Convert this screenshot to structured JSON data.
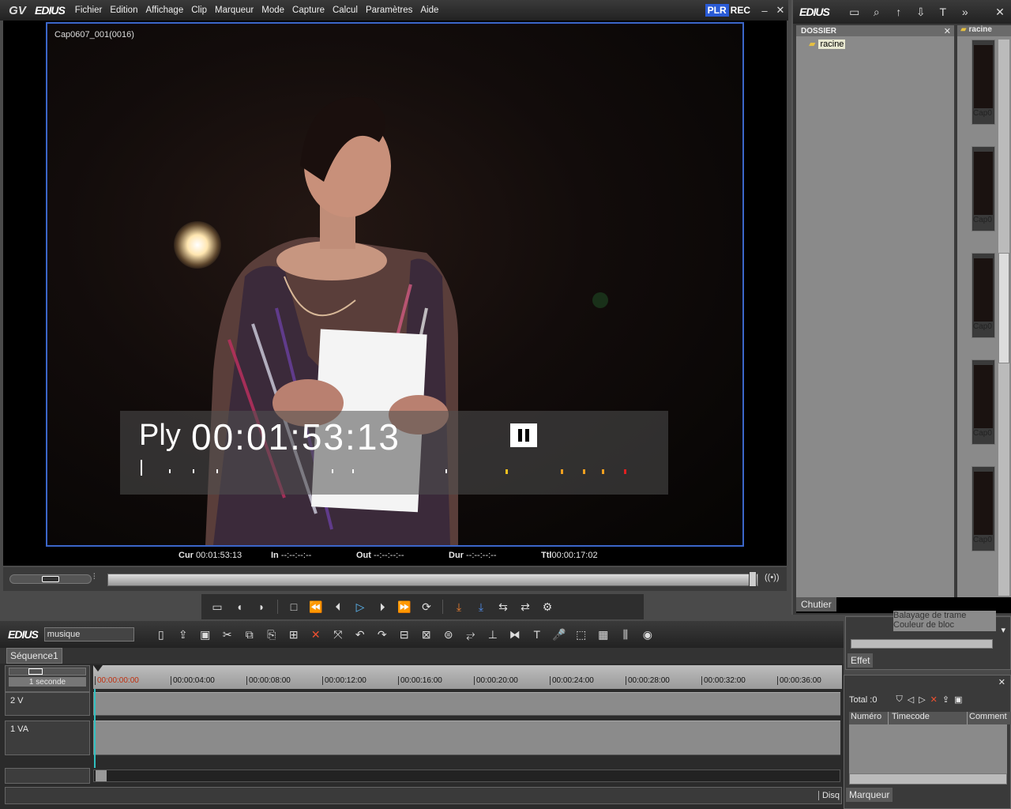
{
  "app": {
    "logo": "EDIUS",
    "plr": "PLR",
    "rec": "REC"
  },
  "menu": [
    "Fichier",
    "Edition",
    "Affichage",
    "Clip",
    "Marqueur",
    "Mode",
    "Capture",
    "Calcul",
    "Paramètres",
    "Aide"
  ],
  "player": {
    "clip_name": "Cap0607_001(0016)",
    "osd_mode": "Ply",
    "osd_timecode": "00:01:53:13",
    "paused": true
  },
  "timecodes": {
    "cur_label": "Cur",
    "cur": "00:01:53:13",
    "in_label": "In",
    "in": "--:--:--:--",
    "out_label": "Out",
    "out": "--:--:--:--",
    "dur_label": "Dur",
    "dur": "--:--:--:--",
    "ttl_label": "Ttl",
    "ttl": "00:00:17:02"
  },
  "bin": {
    "logo": "EDIUS",
    "folder_header": "DOSSIER",
    "root_folder": "racine",
    "tab_label": "racine",
    "clip_label": "Cap0",
    "footer_tab": "Chutier"
  },
  "effect_panel": {
    "items": [
      "Balayage de trame",
      "Couleur de bloc"
    ],
    "tab": "Effet"
  },
  "marker_panel": {
    "total": "Total :0",
    "columns": [
      "Numéro",
      "Timecode",
      "Comment"
    ],
    "tab": "Marqueur"
  },
  "timeline": {
    "logo": "EDIUS",
    "project_name": "musique",
    "sequence_tab": "Séquence1",
    "zoom": "1 seconde",
    "ruler": [
      "00:00:00:00",
      "00:00:04:00",
      "00:00:08:00",
      "00:00:12:00",
      "00:00:16:00",
      "00:00:20:00",
      "00:00:24:00",
      "00:00:28:00",
      "00:00:32:00",
      "00:00:36:00"
    ],
    "tracks": [
      {
        "name": "2 V"
      },
      {
        "name": "1 VA"
      }
    ]
  },
  "status": {
    "disk": "Disq"
  }
}
